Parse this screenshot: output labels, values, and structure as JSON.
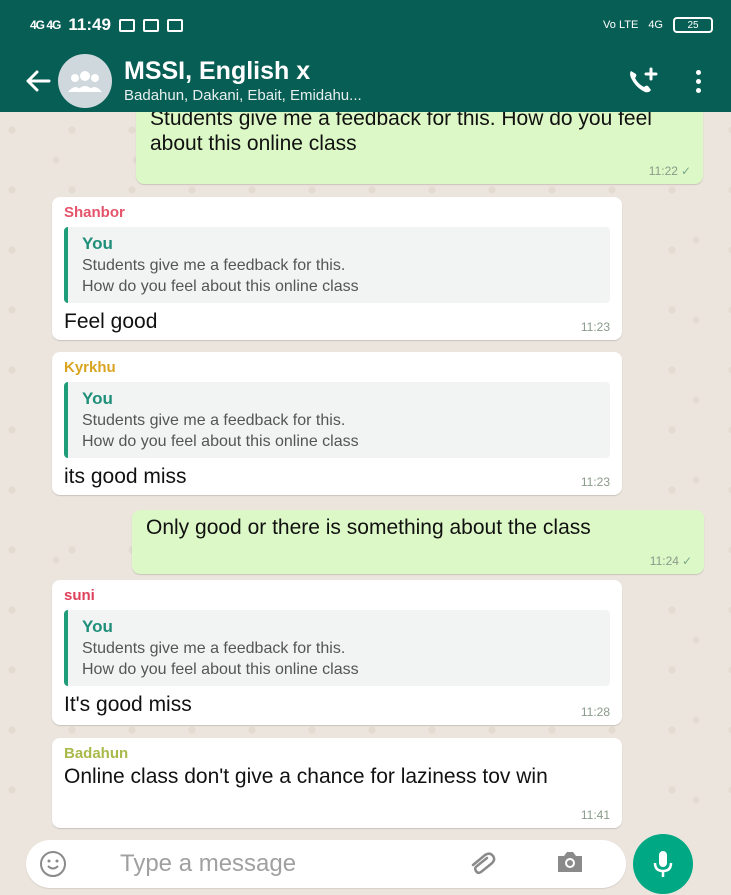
{
  "status_bar": {
    "network": "4G 4G",
    "time": "11:49",
    "right_label": "Vo LTE",
    "network_right": "4G",
    "battery": "25"
  },
  "header": {
    "title": "MSSI,  English x",
    "members": "Badahun, Dakani, Ebait, Emidahu..."
  },
  "messages": [
    {
      "direction": "out",
      "text": "Students give me a feedback for this. How do you feel about this online class",
      "time": "11:22"
    },
    {
      "direction": "in",
      "sender": "Shanbor",
      "sender_color": "#e5536b",
      "quote_author": "You",
      "quote_line1": "Students give me a feedback for this.",
      "quote_line2": "How do you feel about this online class",
      "text": "Feel good",
      "time": "11:23"
    },
    {
      "direction": "in",
      "sender": "Kyrkhu",
      "sender_color": "#d9a521",
      "quote_author": "You",
      "quote_line1": "Students give me a feedback for this.",
      "quote_line2": "How do you feel about this online class",
      "text": "its good miss",
      "time": "11:23"
    },
    {
      "direction": "out",
      "text": "Only good or there is something about the class",
      "time": "11:24"
    },
    {
      "direction": "in",
      "sender": "suni",
      "sender_color": "#e0405a",
      "quote_author": "You",
      "quote_line1": "Students give me a feedback for this.",
      "quote_line2": "How do you feel about this online class",
      "text": "It's good miss",
      "time": "11:28"
    },
    {
      "direction": "in",
      "sender": "Badahun",
      "sender_color": "#a9b94a",
      "text": "Online class don't give a chance for laziness tov win",
      "time": "11:41"
    }
  ],
  "composer": {
    "placeholder": "Type a message"
  },
  "colors": {
    "header": "#075e54",
    "outgoing_bubble": "#dcf8c6",
    "incoming_bubble": "#ffffff",
    "accent": "#00a884"
  },
  "icons": [
    "back-arrow-icon",
    "group-avatar-icon",
    "add-call-icon",
    "more-vert-icon",
    "emoji-icon",
    "attach-icon",
    "camera-icon",
    "mic-icon",
    "read-tick-icon"
  ]
}
